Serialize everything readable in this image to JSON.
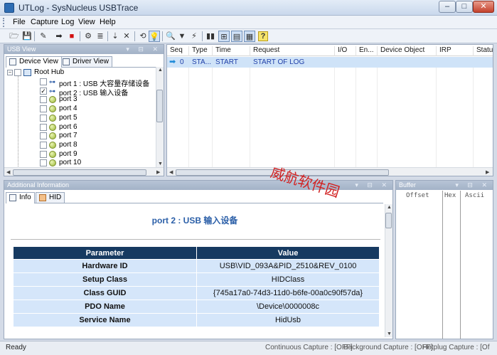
{
  "window": {
    "title": "UTLog - SysNucleus USBTrace",
    "min": "–",
    "max": "□",
    "close": "✕"
  },
  "menu": {
    "items": [
      "File",
      "Capture",
      "Log",
      "View",
      "Help"
    ]
  },
  "usb_view": {
    "title": "USB View",
    "tabs": {
      "device_view": "Device View",
      "driver_view": "Driver View"
    },
    "tree": {
      "root": "Root Hub",
      "ports": [
        {
          "label": "port 1 : USB 大容量存储设备",
          "checked": false,
          "icon": "usb-connector-icon"
        },
        {
          "label": "port 2 : USB 输入设备",
          "checked": true,
          "icon": "usb-connector-icon"
        },
        {
          "label": "port 3",
          "checked": false,
          "icon": "port-icon"
        },
        {
          "label": "port 4",
          "checked": false,
          "icon": "port-icon"
        },
        {
          "label": "port 5",
          "checked": false,
          "icon": "port-icon"
        },
        {
          "label": "port 6",
          "checked": false,
          "icon": "port-icon"
        },
        {
          "label": "port 7",
          "checked": false,
          "icon": "port-icon"
        },
        {
          "label": "port 8",
          "checked": false,
          "icon": "port-icon"
        },
        {
          "label": "port 9",
          "checked": false,
          "icon": "port-icon"
        },
        {
          "label": "port 10",
          "checked": false,
          "icon": "port-icon"
        }
      ]
    }
  },
  "log": {
    "columns": [
      "Seq",
      "Type",
      "Time",
      "Request",
      "I/O",
      "En...",
      "Device Object",
      "IRP",
      "Status"
    ],
    "rows": [
      {
        "seq": "0",
        "type": "STA...",
        "time": "START",
        "request": "START OF LOG"
      }
    ]
  },
  "additional_info": {
    "title": "Additional Information",
    "tabs": {
      "info": "Info",
      "hid": "HID"
    },
    "device_title": "port 2 : USB 输入设备",
    "table": {
      "headers": {
        "param": "Parameter",
        "value": "Value"
      },
      "rows": [
        {
          "name": "Hardware ID",
          "value": "USB\\VID_093A&PID_2510&REV_0100"
        },
        {
          "name": "Setup Class",
          "value": "HIDClass"
        },
        {
          "name": "Class GUID",
          "value": "{745a17a0-74d3-11d0-b6fe-00a0c90f57da}"
        },
        {
          "name": "PDO Name",
          "value": "\\Device\\0000008c"
        },
        {
          "name": "Service Name",
          "value": "HidUsb"
        }
      ]
    }
  },
  "buffer": {
    "title": "Buffer",
    "columns": {
      "offset": "Offset",
      "hex": "Hex",
      "ascii": "Ascii"
    }
  },
  "status": {
    "ready": "Ready",
    "continuous": "Continuous Capture : [OFF]",
    "background": "Background Capture : [OFF]",
    "hotplug": "Hotplug Capture : [Of"
  },
  "watermark": "威航软件园",
  "colors": {
    "accent": "#2b5fa8",
    "table_header": "#163a61",
    "table_cell": "#d5e6fa",
    "selection": "#cfe3f8"
  }
}
